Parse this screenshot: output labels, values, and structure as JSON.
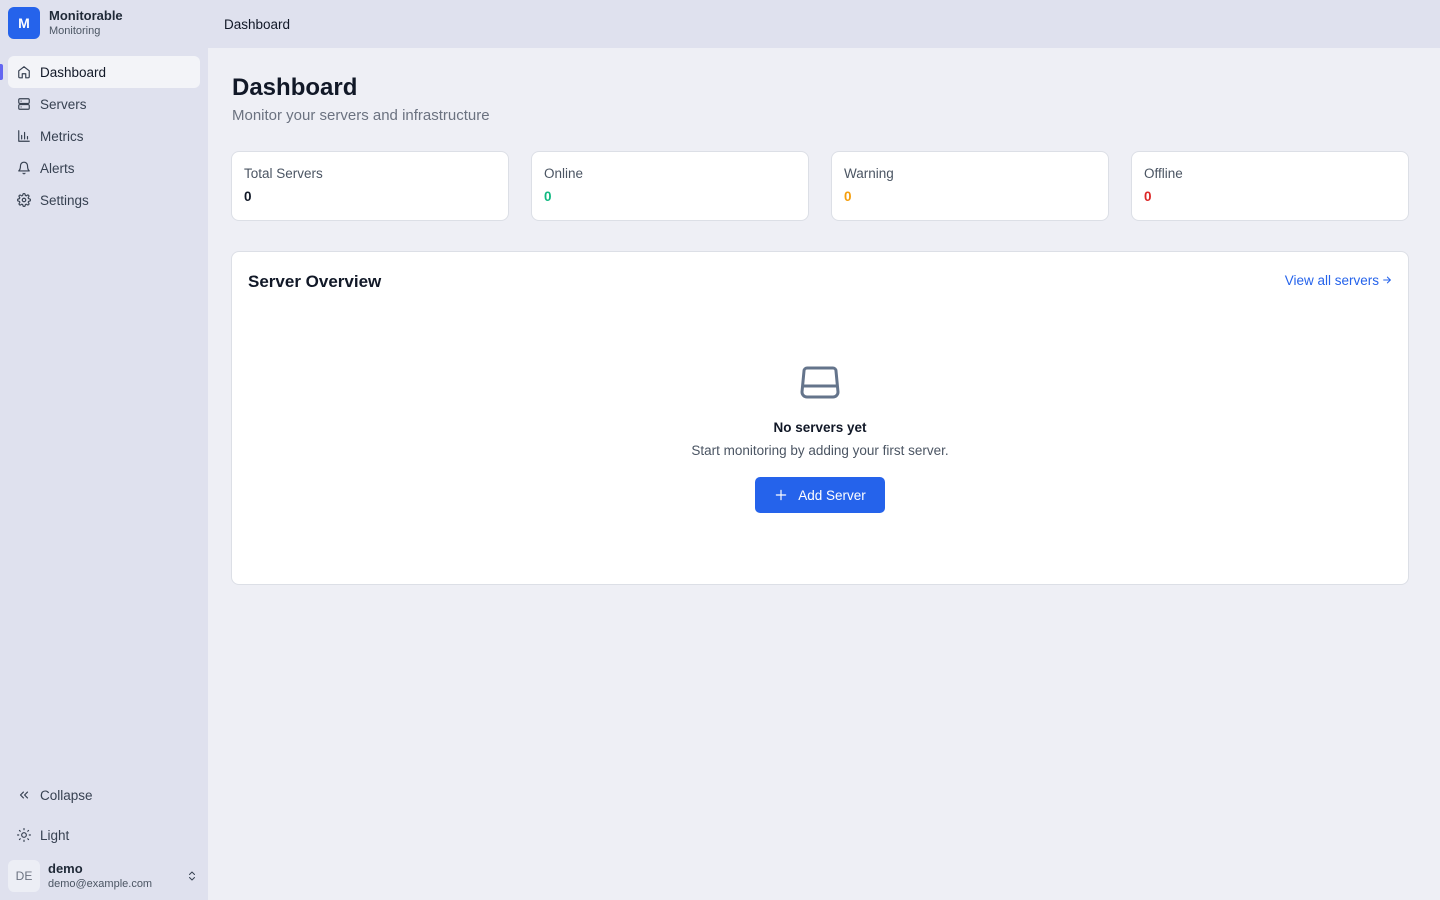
{
  "brand": {
    "logo_letter": "M",
    "name": "Monitorable",
    "subtitle": "Monitoring"
  },
  "sidebar": {
    "items": [
      {
        "label": "Dashboard",
        "icon": "home-icon",
        "active": true
      },
      {
        "label": "Servers",
        "icon": "server-icon",
        "active": false
      },
      {
        "label": "Metrics",
        "icon": "bar-chart-icon",
        "active": false
      },
      {
        "label": "Alerts",
        "icon": "bell-icon",
        "active": false
      },
      {
        "label": "Settings",
        "icon": "gear-icon",
        "active": false
      }
    ],
    "collapse_label": "Collapse",
    "theme_label": "Light"
  },
  "user": {
    "initials": "DE",
    "name": "demo",
    "email": "demo@example.com"
  },
  "topbar": {
    "breadcrumb": "Dashboard"
  },
  "page": {
    "title": "Dashboard",
    "subtitle": "Monitor your servers and infrastructure"
  },
  "stats": [
    {
      "label": "Total Servers",
      "value": "0",
      "color": "#111827"
    },
    {
      "label": "Online",
      "value": "0",
      "color": "#10b981"
    },
    {
      "label": "Warning",
      "value": "0",
      "color": "#f59e0b"
    },
    {
      "label": "Offline",
      "value": "0",
      "color": "#dc2626"
    }
  ],
  "overview": {
    "title": "Server Overview",
    "view_all_label": "View all servers",
    "empty_title": "No servers yet",
    "empty_subtitle": "Start monitoring by adding your first server.",
    "add_button_label": "Add Server"
  },
  "colors": {
    "accent": "#2563eb",
    "active_indicator": "#6366f1"
  }
}
